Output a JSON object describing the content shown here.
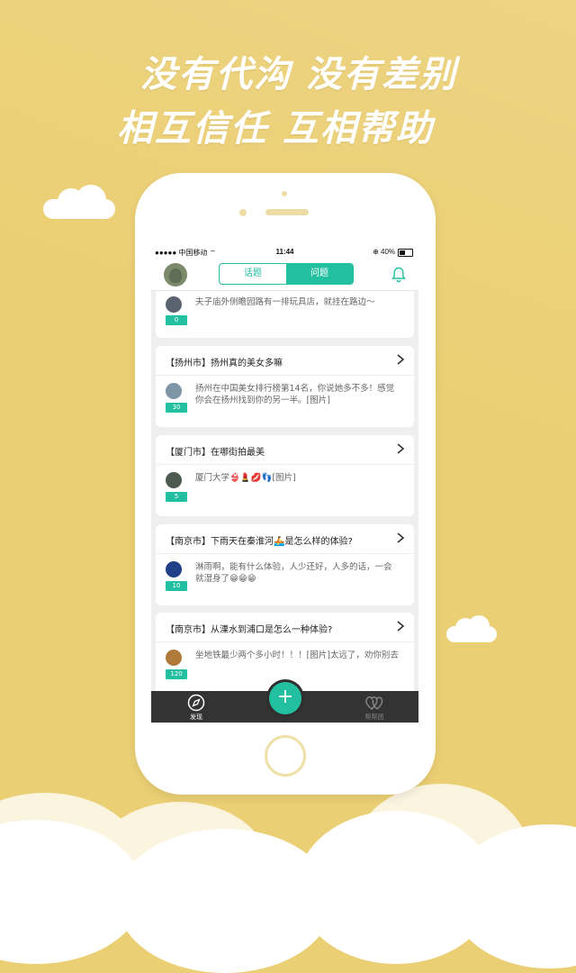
{
  "promo": {
    "headline1": "没有代沟 没有差别",
    "headline2": "相互信任 互相帮助"
  },
  "colors": {
    "background": "#EBCF74",
    "accent": "#22BFA0",
    "tabbar": "#333333"
  },
  "statusbar": {
    "carrier": "●●●●● 中国移动 ⌔",
    "time": "11:44",
    "battery": "⊕ 40%"
  },
  "nav": {
    "tabs": [
      {
        "label": "话题",
        "active": false
      },
      {
        "label": "问题",
        "active": true
      }
    ],
    "bell_icon": "bell-icon"
  },
  "feed": [
    {
      "title": "",
      "answer": "夫子庙外侧瞻园路有一排玩具店，就挂在路边～",
      "count": "0"
    },
    {
      "title": "【扬州市】扬州真的美女多嘛",
      "answer": "扬州在中国美女排行榜第14名，你说她多不多！感觉你会在扬州找到你的另一半。[图片]",
      "count": "30"
    },
    {
      "title": "【厦门市】在哪街拍最美",
      "answer": "厦门大学👙💄💋👣[图片]",
      "count": "5"
    },
    {
      "title": "【南京市】下雨天在秦淮河🚣是怎么样的体验?",
      "answer": "淋雨啊，能有什么体验，人少还好，人多的话，一会就湿身了😁😁😁",
      "count": "10"
    },
    {
      "title": "【南京市】从溧水到浦口是怎么一种体验?",
      "answer": "坐地铁最少两个多小时！！！[图片]太远了，劝你别去",
      "count": "120"
    }
  ],
  "tabbar": {
    "discover_label": "发现",
    "add_label": "+",
    "help_label": "帮帮团"
  }
}
